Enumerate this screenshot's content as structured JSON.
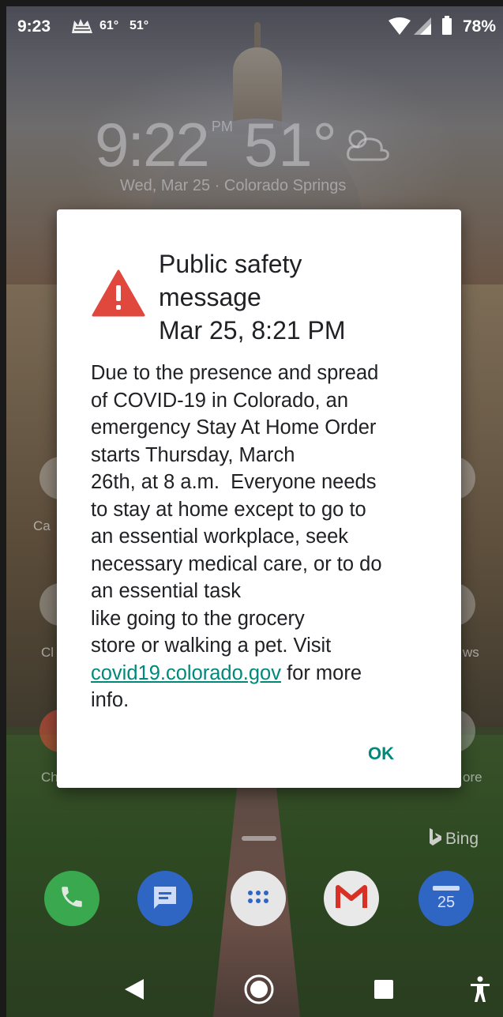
{
  "status_bar": {
    "time": "9:23",
    "weather_icon": "cat-weather-icon",
    "temp_high": "61°",
    "temp_low": "51°",
    "battery_percent": "78%",
    "icons": [
      "wifi-icon",
      "signal-icon",
      "battery-icon"
    ]
  },
  "lockscreen": {
    "clock": "9:22",
    "ampm": "PM",
    "temperature": "51°",
    "weather_icon": "partly-cloudy-icon",
    "subtitle": "Wed, Mar 25 · Colorado Springs"
  },
  "background_labels": {
    "left_row1": "Ca",
    "left_row2": "Cl",
    "left_row3": "Ch",
    "right_row2": "ws",
    "right_row3": "ore"
  },
  "dialog": {
    "icon": "warning-triangle-icon",
    "title_lines": [
      "Public safety",
      "message",
      "Mar 25, 8:21 PM"
    ],
    "body_lines": [
      "Due to the presence and spread",
      "of COVID-19 in Colorado, an",
      "emergency Stay At Home Order",
      "starts Thursday, March",
      "26th, at 8 a.m.  Everyone needs",
      "to stay at home except to go to",
      "an essential workplace, seek",
      "necessary medical care, or to do",
      "an essential task",
      "like going to the grocery",
      "store or walking a pet. Visit"
    ],
    "link_text": "covid19.colorado.gov",
    "link_suffix": " for more",
    "last_line": "info.",
    "ok_label": "OK",
    "accent_color": "#00897b",
    "icon_color": "#e0483e"
  },
  "home": {
    "bing_label": "Bing",
    "dock_apps": [
      "phone-icon",
      "messages-icon",
      "app-drawer-icon",
      "gmail-icon",
      "calendar-icon"
    ],
    "calendar_day": "25"
  },
  "navbar": {
    "buttons": [
      "back-icon",
      "home-icon",
      "recents-icon",
      "accessibility-icon"
    ]
  }
}
